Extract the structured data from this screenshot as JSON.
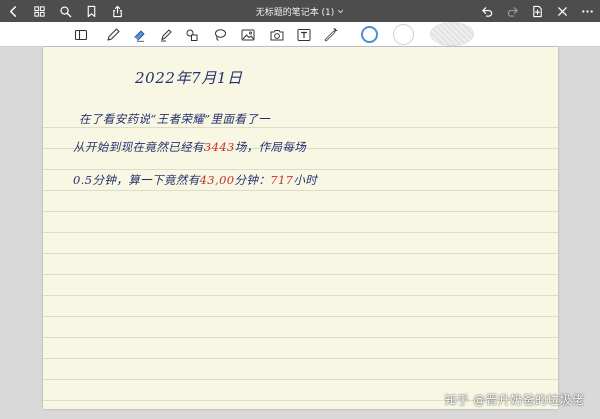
{
  "navbar": {
    "title": "无标题的笔记本 (1)",
    "bg_color": "#4d4d4d"
  },
  "icons": {
    "back": "chevron-left-icon",
    "grid": "grid-icon",
    "search": "search-icon",
    "bookmark": "bookmark-icon",
    "share": "share-icon",
    "undo": "undo-icon",
    "redo": "redo-icon",
    "add_page": "add-page-icon",
    "close": "close-icon",
    "more": "more-icon"
  },
  "toolbar": {
    "tools": [
      "lasso-panel",
      "pen",
      "eraser",
      "highlighter",
      "shapes",
      "lasso",
      "image",
      "camera",
      "text",
      "laser"
    ],
    "swatch_colors": [
      "#4a90d9",
      "#ffffff",
      "#e8e8e8"
    ]
  },
  "note": {
    "date": "2022年7月1日",
    "line1": "在了看安药说“王者荣耀”里面看了一",
    "line2_a": "从开始到现在竟然已经有",
    "line2_num": "3443",
    "line2_b": "场，作局每场",
    "line3_a": "0.5分钟，算一下竟然有",
    "line3_num1": "43,00",
    "line3_b": "分钟：",
    "line3_num2": "717",
    "line3_c": "小时",
    "ink_color": "#24306e",
    "accent_color": "#c8302a",
    "paper_color": "#f8f7e4"
  },
  "watermark": "知乎 @晋升奶爸的垃圾佬"
}
